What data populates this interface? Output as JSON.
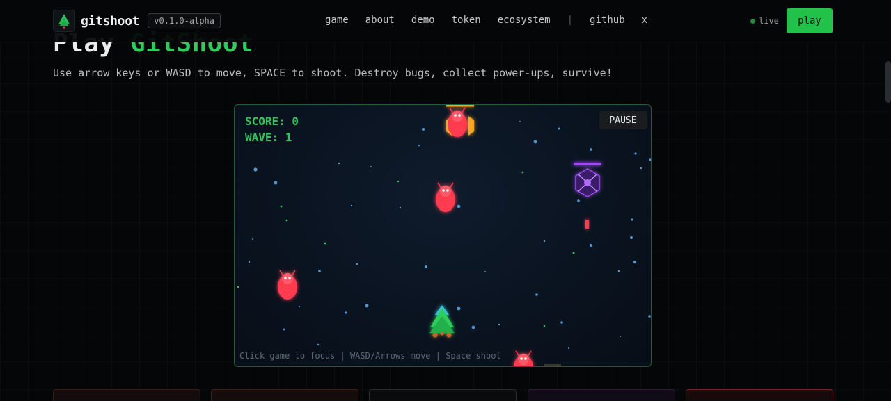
{
  "header": {
    "brand_name": "gitshoot",
    "version": "v0.1.0-alpha",
    "nav": [
      {
        "label": "game"
      },
      {
        "label": "about"
      },
      {
        "label": "demo"
      },
      {
        "label": "token"
      },
      {
        "label": "ecosystem"
      },
      {
        "label": "github"
      },
      {
        "label": "x"
      }
    ],
    "separator": "|",
    "live_label": "live",
    "play_label": "play",
    "live_color": "#1f8a3a",
    "accent_color": "#22c14a"
  },
  "hero": {
    "title_part1": "Play ",
    "title_part2": "GitShoot",
    "subtitle": "Use arrow keys or WASD to move, SPACE to shoot. Destroy bugs, collect power-ups, survive!"
  },
  "game": {
    "score_label": "SCORE: 0",
    "wave_label": "WAVE: 1",
    "pause_label": "PAUSE",
    "hint": "Click game to focus | WASD/Arrows move | Space shoot",
    "icons": [
      "player-ship-icon",
      "bug-enemy-icon",
      "shielded-bug-icon",
      "power-up-icon",
      "tree-logo-icon"
    ],
    "enemy_color": "#ff3b4f",
    "player_color": "#2ecc5a",
    "powerup_color": "#9d4cf0"
  }
}
